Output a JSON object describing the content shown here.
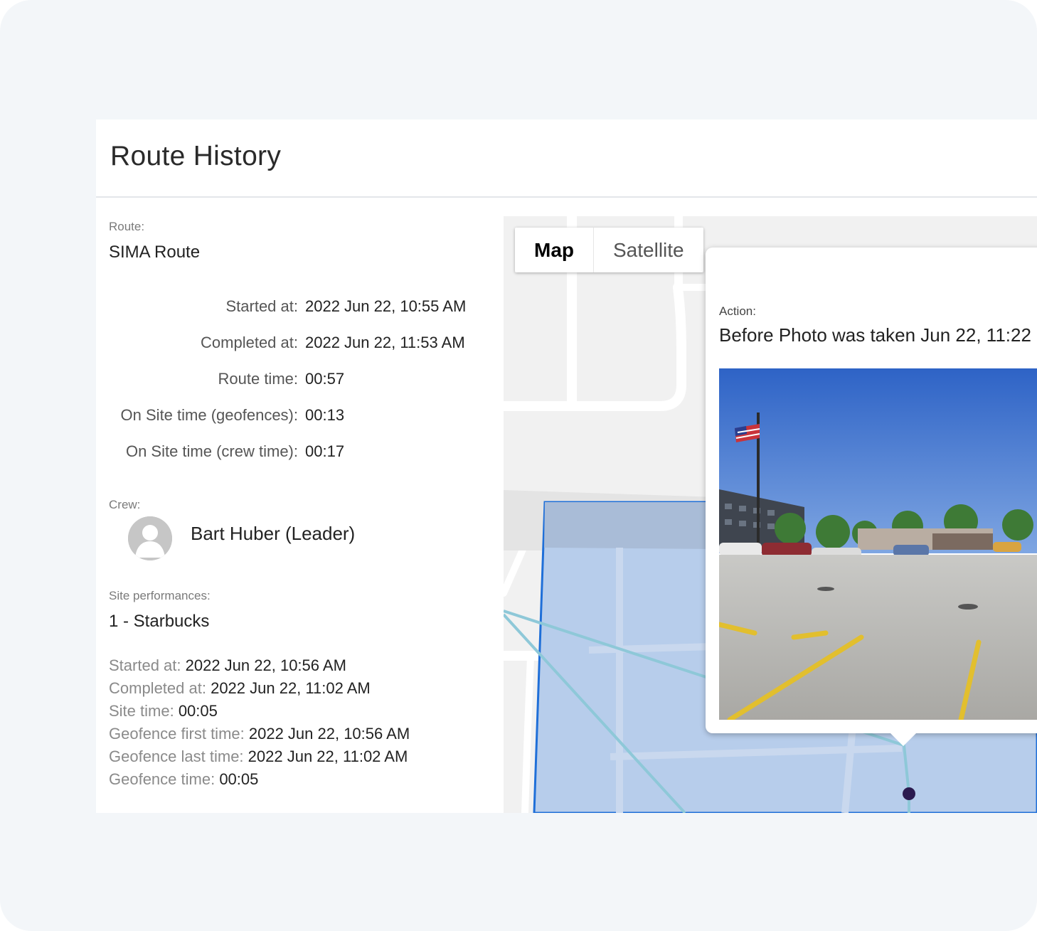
{
  "header": {
    "title": "Route History"
  },
  "route": {
    "label": "Route:",
    "name": "SIMA Route",
    "stats": [
      {
        "label": "Started at:",
        "value": "2022 Jun 22, 10:55 AM"
      },
      {
        "label": "Completed at:",
        "value": "2022 Jun 22, 11:53 AM"
      },
      {
        "label": "Route time:",
        "value": "00:57"
      },
      {
        "label": "On Site time (geofences):",
        "value": "00:13"
      },
      {
        "label": "On Site time (crew time):",
        "value": "00:17"
      }
    ]
  },
  "crew": {
    "label": "Crew:",
    "members": [
      {
        "name": "Bart Huber (Leader)",
        "avatar_icon": "user-avatar-icon"
      }
    ]
  },
  "site_performances": {
    "label": "Site performances:",
    "site": "1 - Starbucks",
    "details": [
      {
        "label": "Started at:",
        "value": "2022 Jun 22, 10:56 AM"
      },
      {
        "label": "Completed at:",
        "value": "2022 Jun 22, 11:02 AM"
      },
      {
        "label": "Site time:",
        "value": "00:05"
      },
      {
        "label": "Geofence first time:",
        "value": "2022 Jun 22, 10:56 AM"
      },
      {
        "label": "Geofence last time:",
        "value": "2022 Jun 22, 11:02 AM"
      },
      {
        "label": "Geofence time:",
        "value": "00:05"
      }
    ]
  },
  "map": {
    "tabs": [
      {
        "label": "Map",
        "active": true
      },
      {
        "label": "Satellite",
        "active": false
      }
    ],
    "popup": {
      "label": "Action:",
      "value": "Before Photo was taken Jun 22, 11:22"
    },
    "colors": {
      "geofence_fill": "#b7cdeb",
      "geofence_stroke": "#1f6fd8",
      "route_line": "#8ec8d8",
      "marker": "#2b1a4f"
    }
  }
}
